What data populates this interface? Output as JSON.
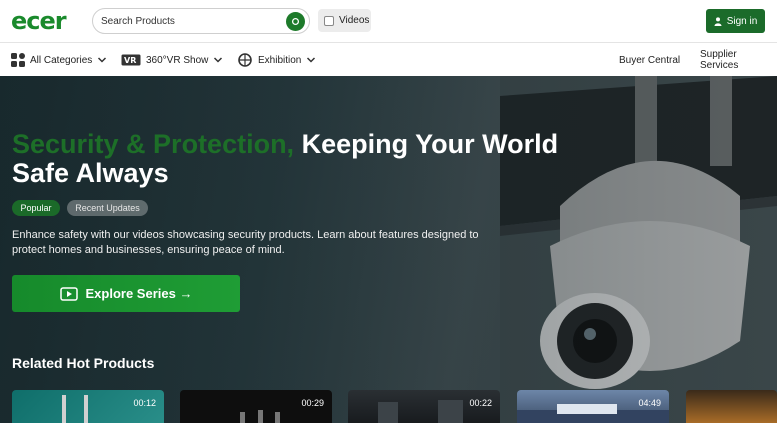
{
  "header": {
    "logo": "ecer",
    "search_placeholder": "Search Products",
    "videos_label": "Videos",
    "signin_label": "Sign in"
  },
  "nav": {
    "all_categories": "All Categories",
    "vr_show": "360°VR Show",
    "exhibition": "Exhibition",
    "buyer_central": "Buyer Central",
    "supplier_services": "Supplier Services"
  },
  "hero": {
    "title_accent": "Security & Protection,",
    "title_rest": " Keeping Your World Safe Always",
    "pills": [
      "Popular",
      "Recent Updates"
    ],
    "description": "Enhance safety with our videos showcasing security products. Learn about features designed to protect homes and businesses, ensuring peace of mind.",
    "cta_label": "Explore Series →"
  },
  "related": {
    "title": "Related Hot Products",
    "durations": [
      "00:12",
      "00:29",
      "00:22",
      "04:49"
    ]
  },
  "colors": {
    "brand_green": "#1a8a2c",
    "signin_green": "#1b6b2a",
    "cta_green": "#1f9d35"
  }
}
